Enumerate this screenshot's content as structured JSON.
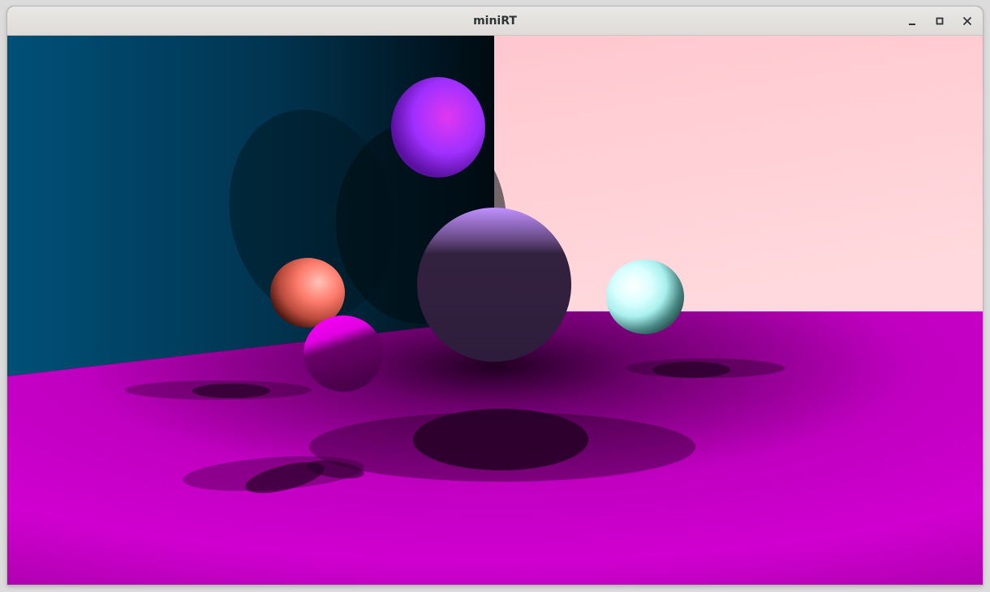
{
  "window": {
    "title": "miniRT",
    "controls": {
      "minimize_icon": "minimize-icon",
      "maximize_icon": "maximize-icon",
      "close_icon": "close-icon"
    }
  },
  "scene": {
    "colors": {
      "left_wall": "#004e78",
      "back_wall": "#ffcdd3",
      "floor": "#c800c8",
      "sphere_large": "#3a2850",
      "sphere_top": "#b030ff",
      "sphere_coral": "#ff7060",
      "sphere_magenta": "#ff00ff",
      "sphere_cyan": "#c8ffff",
      "shadow": "#280028"
    }
  }
}
